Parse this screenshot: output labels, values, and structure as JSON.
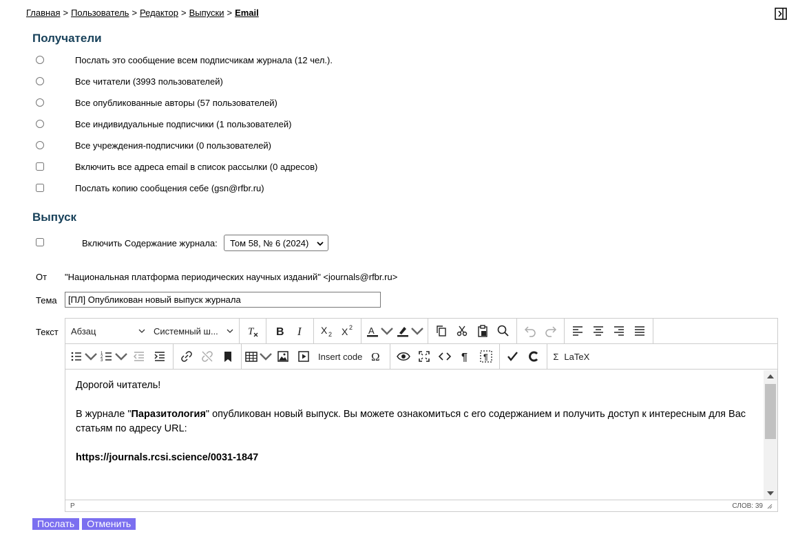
{
  "breadcrumb": {
    "items": [
      "Главная",
      "Пользователь",
      "Редактор",
      "Выпуски"
    ],
    "current": "Email",
    "separator": ">"
  },
  "recipients": {
    "title": "Получатели",
    "options": [
      {
        "type": "radio",
        "label": "Послать это сообщение всем подписчикам журнала (12 чел.)."
      },
      {
        "type": "radio",
        "label": "Все читатели (3993 пользователей)"
      },
      {
        "type": "radio",
        "label": "Все опубликованные авторы (57 пользователей)"
      },
      {
        "type": "radio",
        "label": "Все индивидуальные подписчики (1 пользователей)"
      },
      {
        "type": "radio",
        "label": "Все учреждения-подписчики (0 пользователей)"
      },
      {
        "type": "checkbox",
        "label": "Включить все адреса email в список рассылки (0 адресов)"
      },
      {
        "type": "checkbox",
        "label": "Послать копию сообщения себе (gsn@rfbr.ru)"
      }
    ]
  },
  "issue": {
    "title": "Выпуск",
    "include_toc_label": "Включить Содержание журнала:",
    "selected_issue": "Том 58, № 6 (2024)"
  },
  "from": {
    "label": "От",
    "value": "\"Национальная платформа периодических научных изданий\" <journals@rfbr.ru>"
  },
  "subject": {
    "label": "Тема",
    "value": "[ПЛ] Опубликован новый выпуск журнала"
  },
  "body": {
    "label": "Текст",
    "toolbar": {
      "block_format": "Абзац",
      "font_family": "Системный ш...",
      "insert_code": "Insert code",
      "sigma": "Σ",
      "latex": "LaTeX"
    },
    "paragraphs": {
      "greeting": "Дорогой читатель!",
      "intro_before": "В журнале \"",
      "journal_name": "Паразитология",
      "intro_after": "\" опубликован новый выпуск. Вы можете ознакомиться с его содержанием и получить доступ к интересным для Вас статьям по адресу URL:",
      "url": "https://journals.rcsi.science/0031-1847"
    },
    "status": {
      "path": "P",
      "word_count": "СЛОВ: 39"
    }
  },
  "actions": {
    "send": "Послать",
    "cancel": "Отменить"
  },
  "colors": {
    "heading": "#18415a",
    "button": "#7b6ff0"
  },
  "icons": {
    "panel_toggle": "panel-collapse-icon"
  }
}
